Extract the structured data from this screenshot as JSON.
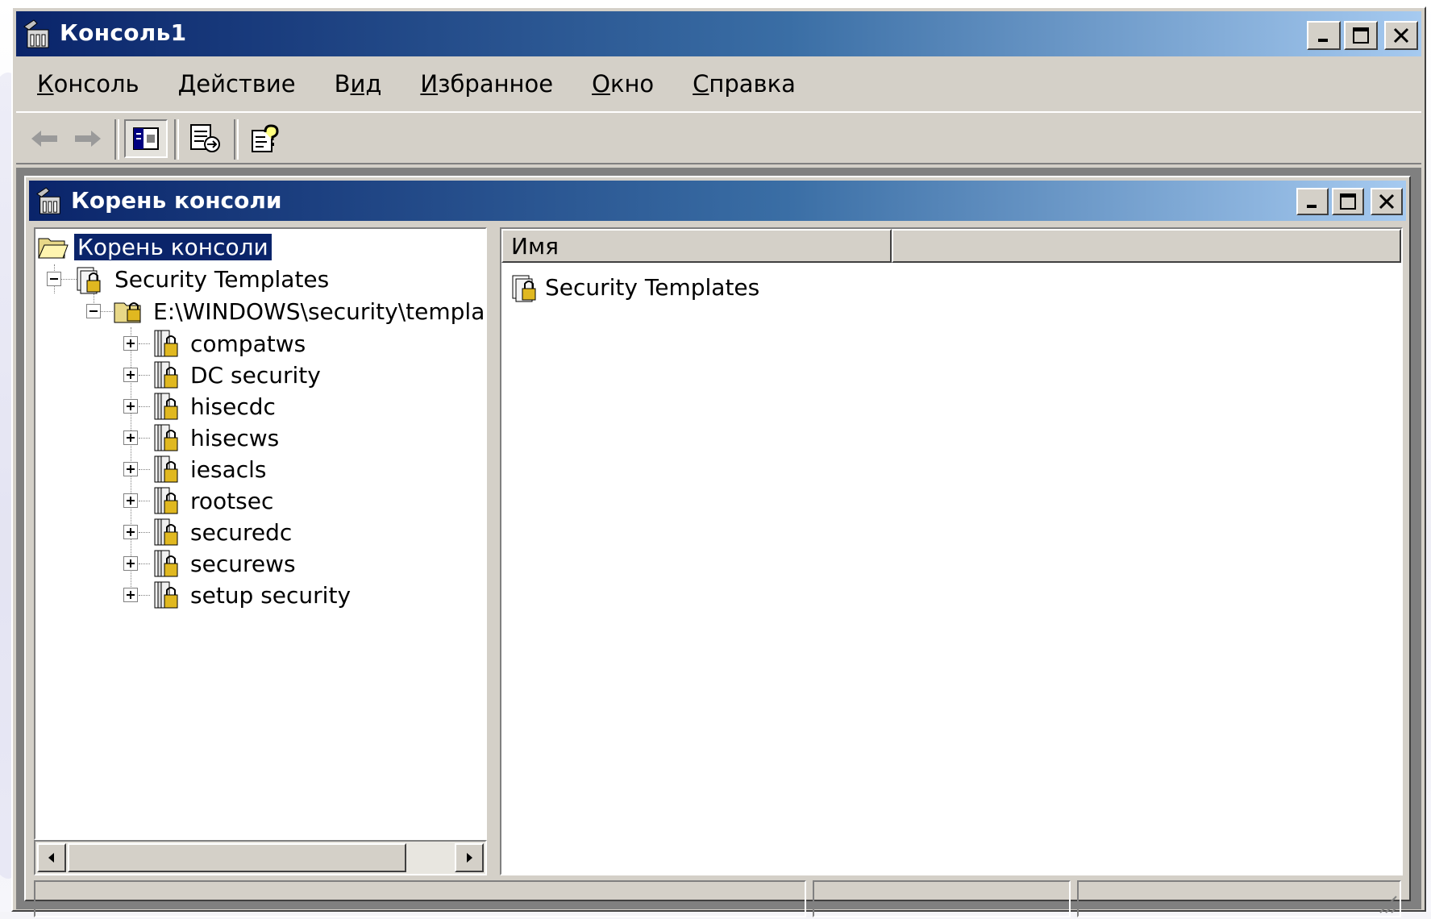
{
  "window": {
    "title": "Консоль1",
    "icon": "mmc-console-icon"
  },
  "menu": [
    {
      "label_u": "К",
      "label_rest": "онсоль"
    },
    {
      "label_u": "Д",
      "label_rest": "ействие"
    },
    {
      "label_u": "В",
      "label_rest": "ид"
    },
    {
      "label_u": "И",
      "label_rest": "збранное"
    },
    {
      "label_u": "О",
      "label_rest": "кно"
    },
    {
      "label_u": "С",
      "label_rest": "правка"
    }
  ],
  "toolbar": {
    "buttons": [
      "back-arrow-icon",
      "forward-arrow-icon",
      "show-hide-tree-icon",
      "export-list-icon",
      "help-icon"
    ]
  },
  "child_window": {
    "title": "Корень консоли"
  },
  "tree": {
    "root": "Корень консоли",
    "security_templates": "Security Templates",
    "path": "E:\\WINDOWS\\security\\templa",
    "templates": [
      "compatws",
      "DC security",
      "hisecdc",
      "hisecws",
      "iesacls",
      "rootsec",
      "securedc",
      "securews",
      "setup security"
    ]
  },
  "list": {
    "columns": [
      "Имя",
      ""
    ],
    "items": [
      "Security Templates"
    ]
  }
}
